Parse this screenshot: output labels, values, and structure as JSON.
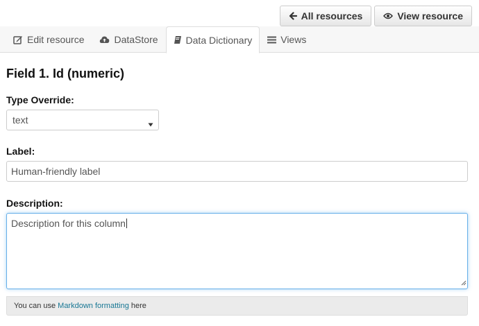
{
  "actions": {
    "all_resources": {
      "label": "All resources",
      "icon": "arrow-left-icon"
    },
    "view_resource": {
      "label": "View resource",
      "icon": "eye-icon"
    }
  },
  "tabs": [
    {
      "label": "Edit resource",
      "icon": "edit-icon",
      "active": false
    },
    {
      "label": "DataStore",
      "icon": "cloud-upload-icon",
      "active": false
    },
    {
      "label": "Data Dictionary",
      "icon": "book-icon",
      "active": true
    },
    {
      "label": "Views",
      "icon": "list-icon",
      "active": false
    }
  ],
  "form": {
    "heading": "Field 1. Id (numeric)",
    "type_override": {
      "label": "Type Override:",
      "value": "text"
    },
    "label_field": {
      "label": "Label:",
      "value": "Human-friendly label"
    },
    "description": {
      "label": "Description:",
      "value": "Description for this column"
    },
    "help": {
      "prefix": "You can use",
      "link": "Markdown formatting",
      "suffix": "here"
    }
  },
  "colors": {
    "link": "#187794",
    "focus_border": "#66afe9",
    "help_bg": "#ebebeb"
  }
}
